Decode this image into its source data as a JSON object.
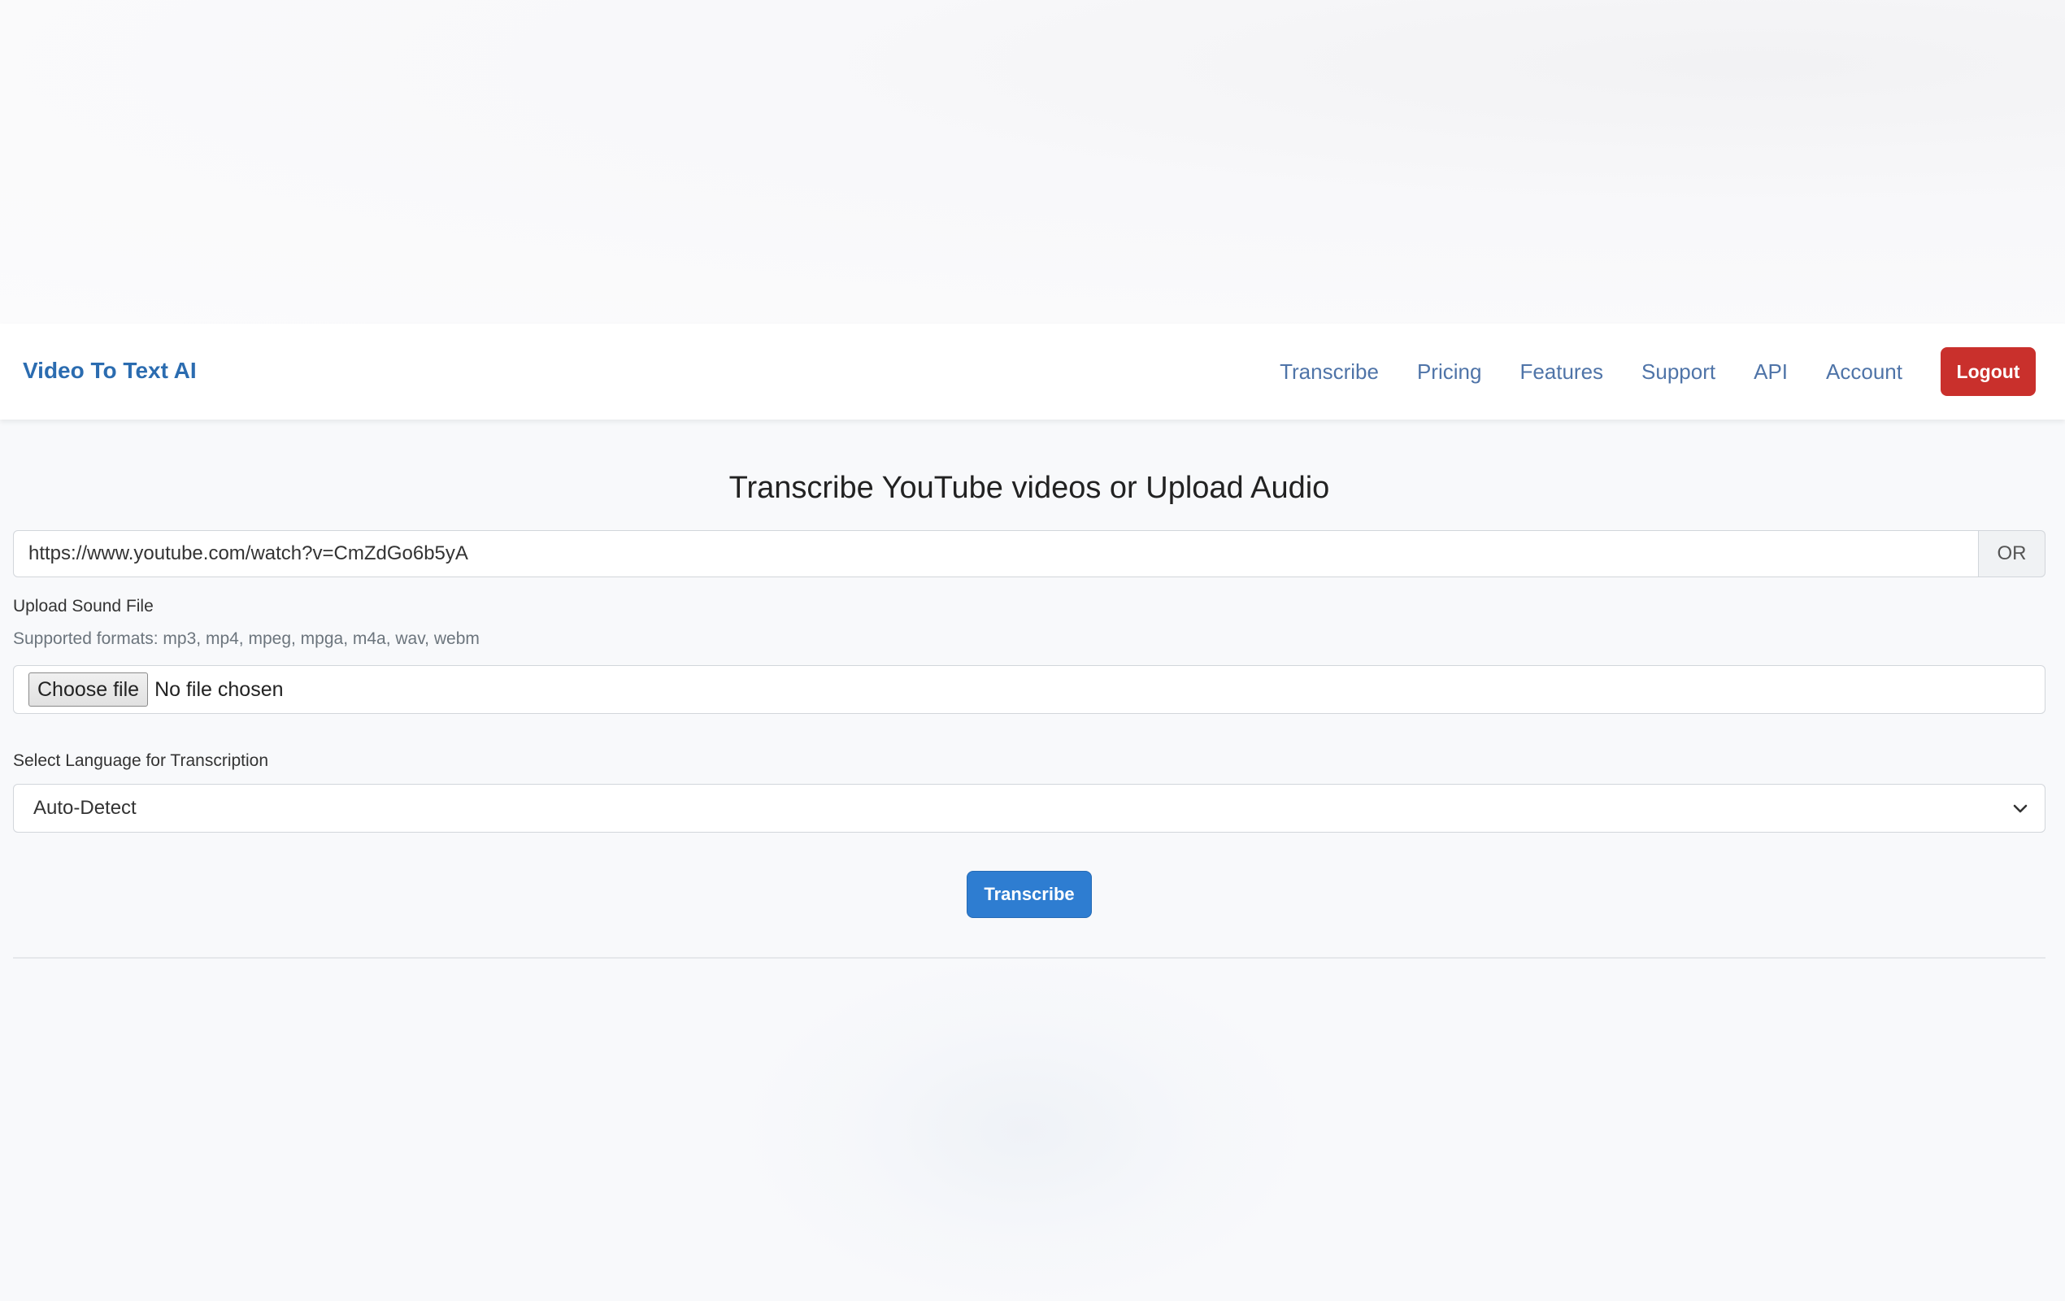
{
  "navbar": {
    "brand": "Video To Text AI",
    "links": [
      "Transcribe",
      "Pricing",
      "Features",
      "Support",
      "API",
      "Account"
    ],
    "logout_label": "Logout"
  },
  "main": {
    "title": "Transcribe YouTube videos or Upload Audio",
    "url_input": {
      "value": "https://www.youtube.com/watch?v=CmZdGo6b5yA",
      "addon": "OR"
    },
    "upload": {
      "label": "Upload Sound File",
      "help": "Supported formats: mp3, mp4, mpeg, mpga, m4a, wav, webm",
      "button_label": "Choose file",
      "status": "No file chosen"
    },
    "language": {
      "label": "Select Language for Transcription",
      "selected": "Auto-Detect",
      "icon": "chevron-down-icon"
    },
    "submit_label": "Transcribe"
  },
  "colors": {
    "brand": "#2b6cb0",
    "nav_link": "#4f74a8",
    "logout": "#c9302c",
    "primary_button": "#2e7dd1"
  }
}
